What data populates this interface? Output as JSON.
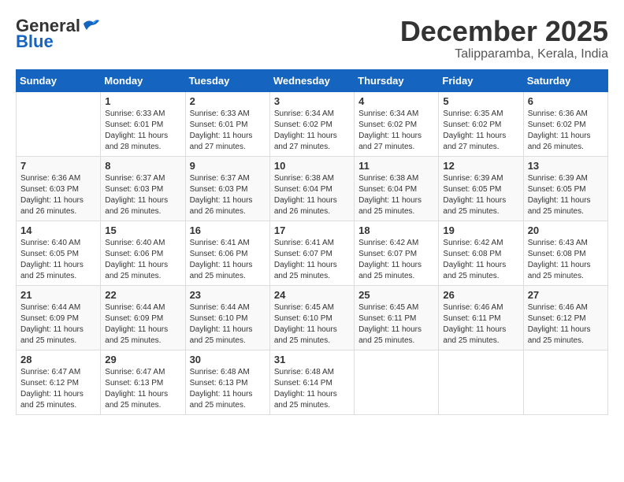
{
  "logo": {
    "general": "General",
    "blue": "Blue"
  },
  "title": "December 2025",
  "location": "Talipparamba, Kerala, India",
  "days_of_week": [
    "Sunday",
    "Monday",
    "Tuesday",
    "Wednesday",
    "Thursday",
    "Friday",
    "Saturday"
  ],
  "weeks": [
    [
      {
        "day": "",
        "info": ""
      },
      {
        "day": "1",
        "info": "Sunrise: 6:33 AM\nSunset: 6:01 PM\nDaylight: 11 hours\nand 28 minutes."
      },
      {
        "day": "2",
        "info": "Sunrise: 6:33 AM\nSunset: 6:01 PM\nDaylight: 11 hours\nand 27 minutes."
      },
      {
        "day": "3",
        "info": "Sunrise: 6:34 AM\nSunset: 6:02 PM\nDaylight: 11 hours\nand 27 minutes."
      },
      {
        "day": "4",
        "info": "Sunrise: 6:34 AM\nSunset: 6:02 PM\nDaylight: 11 hours\nand 27 minutes."
      },
      {
        "day": "5",
        "info": "Sunrise: 6:35 AM\nSunset: 6:02 PM\nDaylight: 11 hours\nand 27 minutes."
      },
      {
        "day": "6",
        "info": "Sunrise: 6:36 AM\nSunset: 6:02 PM\nDaylight: 11 hours\nand 26 minutes."
      }
    ],
    [
      {
        "day": "7",
        "info": "Sunrise: 6:36 AM\nSunset: 6:03 PM\nDaylight: 11 hours\nand 26 minutes."
      },
      {
        "day": "8",
        "info": "Sunrise: 6:37 AM\nSunset: 6:03 PM\nDaylight: 11 hours\nand 26 minutes."
      },
      {
        "day": "9",
        "info": "Sunrise: 6:37 AM\nSunset: 6:03 PM\nDaylight: 11 hours\nand 26 minutes."
      },
      {
        "day": "10",
        "info": "Sunrise: 6:38 AM\nSunset: 6:04 PM\nDaylight: 11 hours\nand 26 minutes."
      },
      {
        "day": "11",
        "info": "Sunrise: 6:38 AM\nSunset: 6:04 PM\nDaylight: 11 hours\nand 25 minutes."
      },
      {
        "day": "12",
        "info": "Sunrise: 6:39 AM\nSunset: 6:05 PM\nDaylight: 11 hours\nand 25 minutes."
      },
      {
        "day": "13",
        "info": "Sunrise: 6:39 AM\nSunset: 6:05 PM\nDaylight: 11 hours\nand 25 minutes."
      }
    ],
    [
      {
        "day": "14",
        "info": "Sunrise: 6:40 AM\nSunset: 6:05 PM\nDaylight: 11 hours\nand 25 minutes."
      },
      {
        "day": "15",
        "info": "Sunrise: 6:40 AM\nSunset: 6:06 PM\nDaylight: 11 hours\nand 25 minutes."
      },
      {
        "day": "16",
        "info": "Sunrise: 6:41 AM\nSunset: 6:06 PM\nDaylight: 11 hours\nand 25 minutes."
      },
      {
        "day": "17",
        "info": "Sunrise: 6:41 AM\nSunset: 6:07 PM\nDaylight: 11 hours\nand 25 minutes."
      },
      {
        "day": "18",
        "info": "Sunrise: 6:42 AM\nSunset: 6:07 PM\nDaylight: 11 hours\nand 25 minutes."
      },
      {
        "day": "19",
        "info": "Sunrise: 6:42 AM\nSunset: 6:08 PM\nDaylight: 11 hours\nand 25 minutes."
      },
      {
        "day": "20",
        "info": "Sunrise: 6:43 AM\nSunset: 6:08 PM\nDaylight: 11 hours\nand 25 minutes."
      }
    ],
    [
      {
        "day": "21",
        "info": "Sunrise: 6:44 AM\nSunset: 6:09 PM\nDaylight: 11 hours\nand 25 minutes."
      },
      {
        "day": "22",
        "info": "Sunrise: 6:44 AM\nSunset: 6:09 PM\nDaylight: 11 hours\nand 25 minutes."
      },
      {
        "day": "23",
        "info": "Sunrise: 6:44 AM\nSunset: 6:10 PM\nDaylight: 11 hours\nand 25 minutes."
      },
      {
        "day": "24",
        "info": "Sunrise: 6:45 AM\nSunset: 6:10 PM\nDaylight: 11 hours\nand 25 minutes."
      },
      {
        "day": "25",
        "info": "Sunrise: 6:45 AM\nSunset: 6:11 PM\nDaylight: 11 hours\nand 25 minutes."
      },
      {
        "day": "26",
        "info": "Sunrise: 6:46 AM\nSunset: 6:11 PM\nDaylight: 11 hours\nand 25 minutes."
      },
      {
        "day": "27",
        "info": "Sunrise: 6:46 AM\nSunset: 6:12 PM\nDaylight: 11 hours\nand 25 minutes."
      }
    ],
    [
      {
        "day": "28",
        "info": "Sunrise: 6:47 AM\nSunset: 6:12 PM\nDaylight: 11 hours\nand 25 minutes."
      },
      {
        "day": "29",
        "info": "Sunrise: 6:47 AM\nSunset: 6:13 PM\nDaylight: 11 hours\nand 25 minutes."
      },
      {
        "day": "30",
        "info": "Sunrise: 6:48 AM\nSunset: 6:13 PM\nDaylight: 11 hours\nand 25 minutes."
      },
      {
        "day": "31",
        "info": "Sunrise: 6:48 AM\nSunset: 6:14 PM\nDaylight: 11 hours\nand 25 minutes."
      },
      {
        "day": "",
        "info": ""
      },
      {
        "day": "",
        "info": ""
      },
      {
        "day": "",
        "info": ""
      }
    ]
  ]
}
